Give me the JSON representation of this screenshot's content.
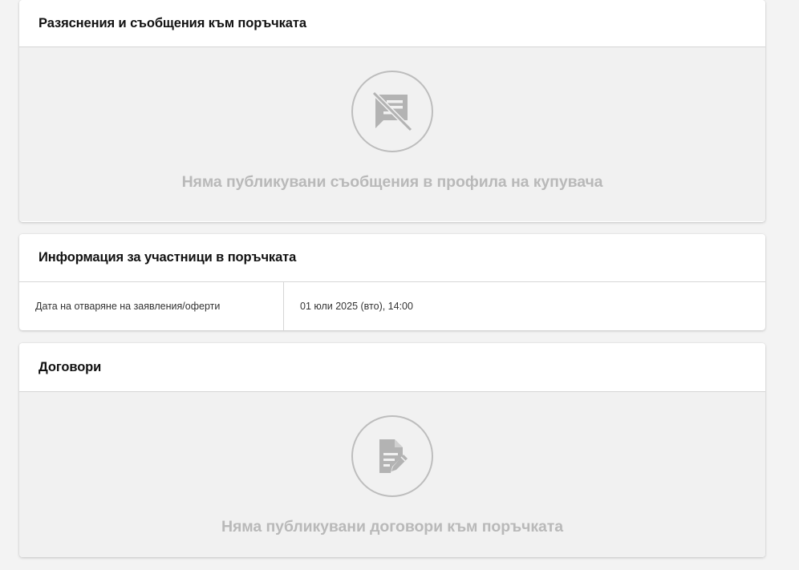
{
  "messages_section": {
    "title": "Разяснения и съобщения към поръчката",
    "empty_icon": "no-messages-icon",
    "empty_text": "Няма публикувани съобщения в профила на купувача"
  },
  "participants_section": {
    "title": "Информация за участници в поръчката",
    "rows": [
      {
        "label": "Дата на отваряне на заявления/оферти",
        "value": "01 юли 2025 (вто), 14:00"
      }
    ]
  },
  "contracts_section": {
    "title": "Договори",
    "empty_icon": "document-edit-icon",
    "empty_text": "Няма публикувани договори към поръчката"
  },
  "colors": {
    "page_background": "#f3f3f3",
    "empty_background": "#f1f1f1",
    "muted_text": "#b9b9b9",
    "icon_gray": "#b3b3b3"
  }
}
